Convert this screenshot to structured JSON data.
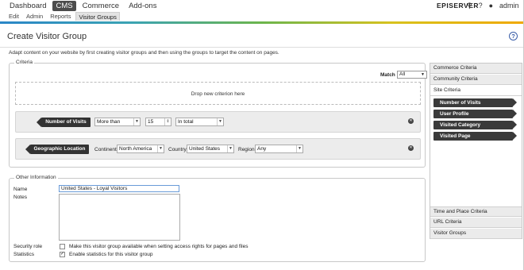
{
  "top_nav": [
    "Dashboard",
    "CMS",
    "Commerce",
    "Add-ons"
  ],
  "top_nav_active": "CMS",
  "brand": "EPISERVER",
  "user_name": "admin",
  "sub_nav": [
    "Edit",
    "Admin",
    "Reports",
    "Visitor Groups"
  ],
  "sub_nav_active": "Visitor Groups",
  "page_title": "Create Visitor Group",
  "intro_text": "Adapt content on your website by first creating visitor groups and then using the groups to target the content on pages.",
  "criteria": {
    "legend": "Criteria",
    "match_label": "Match",
    "match_value": "All",
    "drop_text": "Drop new criterion here",
    "rows": [
      {
        "name": "Number of Visits",
        "comparison": "More than",
        "count": "15",
        "period": "In total"
      },
      {
        "name": "Geographic Location",
        "continent_label": "Continent",
        "continent": "North America",
        "country_label": "Country",
        "country": "United States",
        "region_label": "Region",
        "region": "Any"
      }
    ]
  },
  "other_info": {
    "legend": "Other Information",
    "name_label": "Name",
    "name_value": "United States - Loyal Visitors",
    "notes_label": "Notes",
    "notes_value": "",
    "security_label": "Security role",
    "security_text": "Make this visitor group available when setting access rights for pages and files",
    "security_checked": false,
    "stats_label": "Statistics",
    "stats_text": "Enable statistics for this visitor group",
    "stats_checked": true
  },
  "right_panel": {
    "headers_top": [
      "Commerce Criteria",
      "Community Criteria",
      "Site Criteria"
    ],
    "site_criteria_items": [
      "Number of Visits",
      "User Profile",
      "Visited Category",
      "Visited Page"
    ],
    "headers_bottom": [
      "Time and Place Criteria",
      "URL Criteria",
      "Visitor Groups"
    ]
  },
  "colors": {
    "accent_gradient": [
      "#2a86c7",
      "#6cb54c",
      "#f0a800"
    ],
    "dark_tag": "#333333"
  }
}
